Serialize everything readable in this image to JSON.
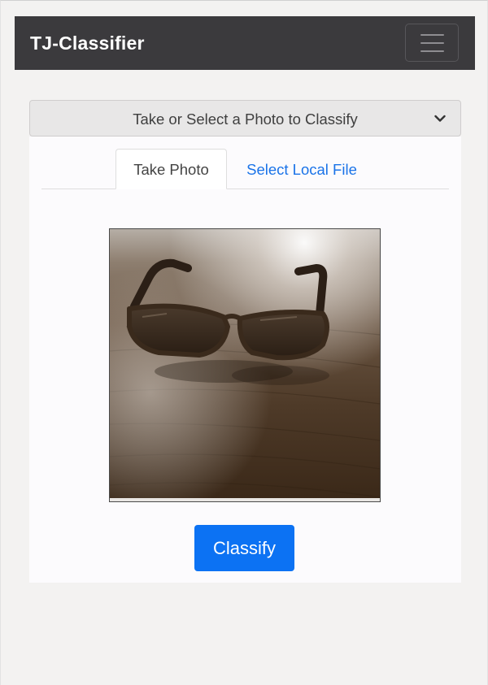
{
  "navbar": {
    "brand": "TJ-Classifier",
    "toggler_icon": "hamburger-menu-icon"
  },
  "accordion": {
    "title": "Take or Select a Photo to Classify",
    "toggle_icon": "chevron-down-icon"
  },
  "tabs": [
    {
      "label": "Take Photo",
      "active": true
    },
    {
      "label": "Select Local File",
      "active": false
    }
  ],
  "photo": {
    "subject": "sunglasses on wooden table"
  },
  "actions": {
    "classify_label": "Classify"
  },
  "colors": {
    "navbar_bg": "#3b3a3d",
    "accent": "#0c72f3",
    "link": "#1a73e8"
  }
}
